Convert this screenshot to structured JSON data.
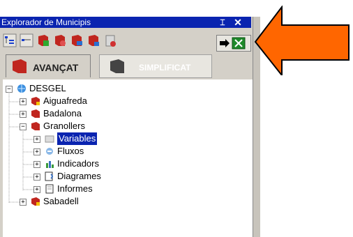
{
  "window": {
    "title": "Explorador de Municipis",
    "pin_icon": "pin-icon",
    "close_icon": "close-icon"
  },
  "toolbar": {
    "buttons": [
      "tree-view-icon",
      "list-view-icon",
      "add-book-icon",
      "edit-book-icon",
      "book-arrow-icon",
      "book-link-icon",
      "delete-icon"
    ],
    "export_icon": "excel-export-icon"
  },
  "tabs": {
    "advanced_label": "AVANÇAT",
    "simplified_label": "SIMPLIFICAT"
  },
  "tree": {
    "root": "DESGEL",
    "items": [
      {
        "label": "Aiguafreda",
        "level": 1,
        "expanded": false
      },
      {
        "label": "Badalona",
        "level": 1,
        "expanded": false
      },
      {
        "label": "Granollers",
        "level": 1,
        "expanded": true
      },
      {
        "label": "Variables",
        "level": 2,
        "expanded": false,
        "selected": true
      },
      {
        "label": "Fluxos",
        "level": 2,
        "expanded": false
      },
      {
        "label": "Indicadors",
        "level": 2,
        "expanded": false
      },
      {
        "label": "Diagrames",
        "level": 2,
        "expanded": false
      },
      {
        "label": "Informes",
        "level": 2,
        "expanded": false
      },
      {
        "label": "Sabadell",
        "level": 1,
        "expanded": false
      }
    ]
  },
  "colors": {
    "titlebar": "#0a24b0",
    "arrow": "#ff6600",
    "export_green": "#1f8a2a"
  }
}
